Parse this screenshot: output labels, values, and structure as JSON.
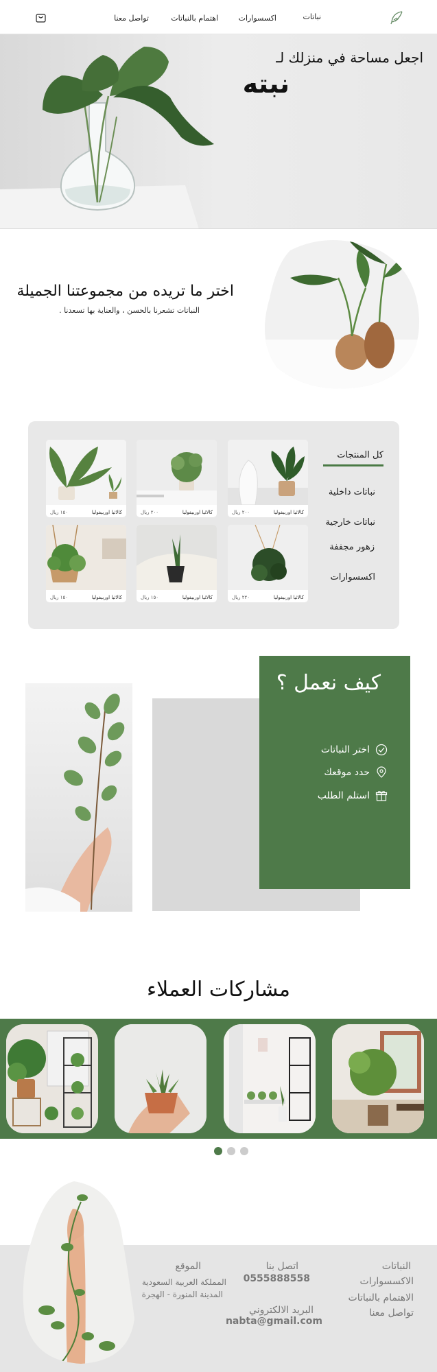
{
  "nav": {
    "items": [
      "نباتات",
      "اكسسوارات",
      "اهتمام بالنباتات",
      "تواصل معنا"
    ]
  },
  "hero": {
    "line1": "اجعل مساحة في منزلك لـ",
    "line2": "نبته"
  },
  "intro": {
    "title": "اختر ما تريده من مجموعتنا الجميلة",
    "subtitle": "النباتات تشعرنا بالحسن ، والعناية بها تسعدنا ."
  },
  "products": {
    "categories": [
      {
        "label": "كل المنتجات",
        "active": true
      },
      {
        "label": "نباتات داخلية",
        "active": false
      },
      {
        "label": "نباتات خارجية",
        "active": false
      },
      {
        "label": "زهور مجففة",
        "active": false
      },
      {
        "label": "اكسسوارات",
        "active": false
      }
    ],
    "cards": [
      {
        "name": "كالاثيا اوربيفوليا",
        "price": "٢٠٠ ريال"
      },
      {
        "name": "كالاثيا اوربيفوليا",
        "price": "٢٠٠ ريال"
      },
      {
        "name": "كالاثيا اوربيفوليا",
        "price": "١٥٠ ريال"
      },
      {
        "name": "كالاثيا اوربيفوليا",
        "price": "٢٢٠ ريال"
      },
      {
        "name": "كالاثيا اوربيفوليا",
        "price": "١٥٠ ريال"
      },
      {
        "name": "كالاثيا اوربيفوليا",
        "price": "١٥٠ ريال"
      }
    ]
  },
  "how": {
    "title": "كيف نعمل ؟",
    "steps": [
      {
        "label": "اختر النباتات",
        "icon": "check-circle-icon"
      },
      {
        "label": "حدد موقعك",
        "icon": "location-pin-icon"
      },
      {
        "label": "استلم الطلب",
        "icon": "gift-icon"
      }
    ]
  },
  "customers": {
    "title": "مشاركات العملاء"
  },
  "footer": {
    "links": [
      "النباتات",
      "الاكسسوارات",
      "الاهتمام بالنباتات",
      "تواصل معنا"
    ],
    "contact_title": "اتصل بنا",
    "phone": "0555888558",
    "email_title": "البريد الالكتروني",
    "email": "nabta@gmail.com",
    "location_title": "الموقع",
    "location_line1": "المملكة العربية السعودية",
    "location_line2": "المدينة المنورة - الهجرة"
  },
  "colors": {
    "brand_green": "#4e7a49",
    "panel_gray": "#e8e8e8"
  }
}
